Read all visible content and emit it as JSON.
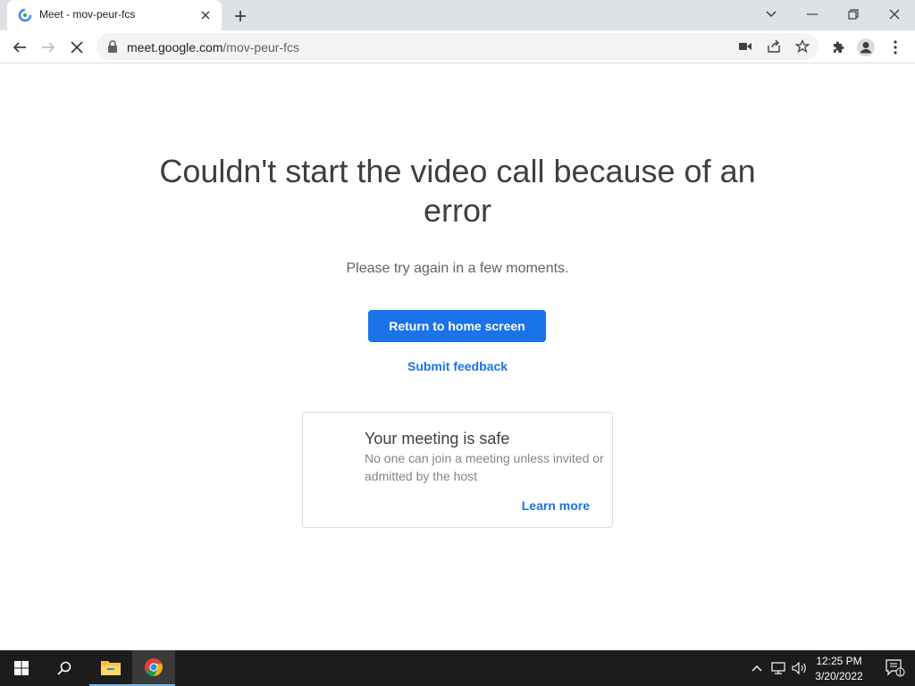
{
  "browser": {
    "tab": {
      "title": "Meet - mov-peur-fcs"
    },
    "address": {
      "host": "meet.google.com",
      "path": "/mov-peur-fcs"
    }
  },
  "page": {
    "heading": "Couldn't start the video call because of an error",
    "subtext": "Please try again in a few moments.",
    "primary_button": "Return to home screen",
    "feedback_link": "Submit feedback",
    "card": {
      "title": "Your meeting is safe",
      "text": "No one can join a meeting unless invited or admitted by the host",
      "link": "Learn more"
    }
  },
  "taskbar": {
    "time": "12:25 PM",
    "date": "3/20/2022",
    "notification_count": "1"
  },
  "colors": {
    "accent": "#1a73e8",
    "heading": "#3c4043",
    "taskbar": "#1c1c1c"
  }
}
